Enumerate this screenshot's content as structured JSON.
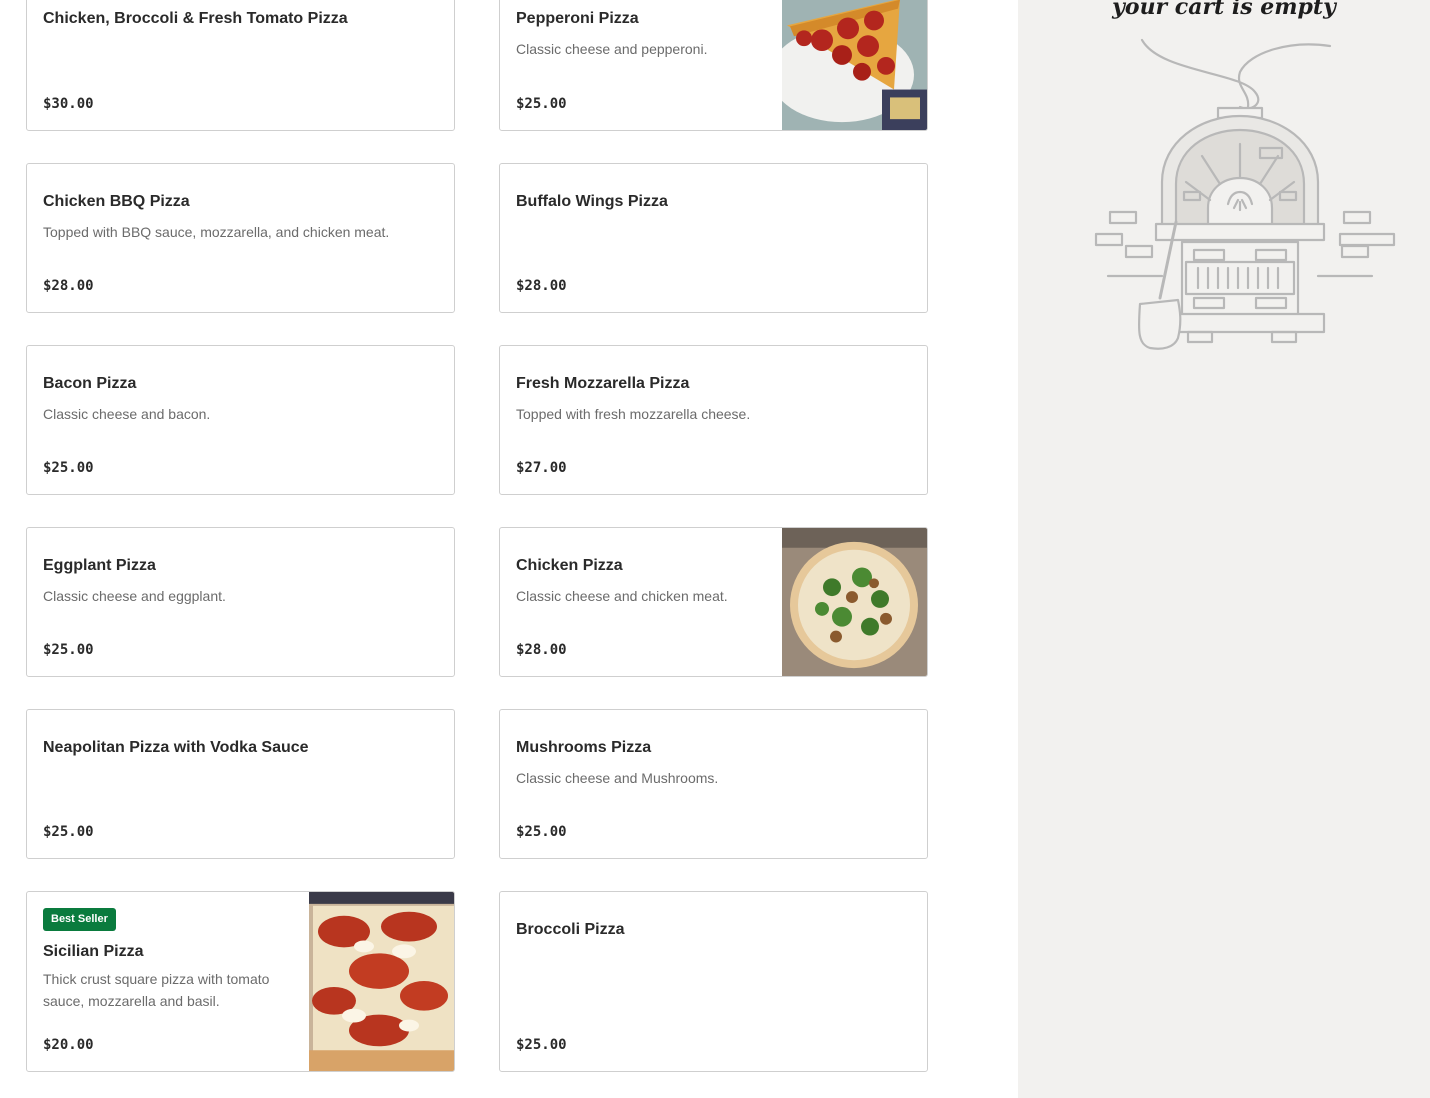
{
  "menu": {
    "items": [
      {
        "name": "Chicken, Broccoli & Fresh Tomato Pizza",
        "description": "",
        "price": "$30.00"
      },
      {
        "name": "Pepperoni Pizza",
        "description": "Classic cheese and pepperoni.",
        "price": "$25.00",
        "image": "pepperoni-slice-photo"
      },
      {
        "name": "Chicken BBQ Pizza",
        "description": "Topped with BBQ sauce, mozzarella, and chicken meat.",
        "price": "$28.00"
      },
      {
        "name": "Buffalo Wings Pizza",
        "description": "",
        "price": "$28.00"
      },
      {
        "name": "Bacon Pizza",
        "description": "Classic cheese and bacon.",
        "price": "$25.00"
      },
      {
        "name": "Fresh Mozzarella Pizza",
        "description": "Topped with fresh mozzarella cheese.",
        "price": "$27.00"
      },
      {
        "name": "Eggplant Pizza",
        "description": "Classic cheese and eggplant.",
        "price": "$25.00"
      },
      {
        "name": "Chicken Pizza",
        "description": "Classic cheese and chicken meat.",
        "price": "$28.00",
        "image": "chicken-pizza-photo"
      },
      {
        "name": "Neapolitan Pizza with Vodka Sauce",
        "description": "",
        "price": "$25.00"
      },
      {
        "name": "Mushrooms Pizza",
        "description": "Classic cheese and Mushrooms.",
        "price": "$25.00"
      },
      {
        "name": "Sicilian Pizza",
        "description": "Thick crust square pizza with tomato sauce, mozzarella and basil.",
        "price": "$20.00",
        "badge": "Best Seller",
        "image": "sicilian-pizza-photo"
      },
      {
        "name": "Broccoli Pizza",
        "description": "",
        "price": "$25.00"
      }
    ]
  },
  "cart": {
    "empty_message": "your cart is empty",
    "illustration": "pizza-oven-icon"
  },
  "colors": {
    "badge": "#0a7b3e",
    "cart_background": "#f2f1ef",
    "card_border": "#cfcfcf"
  }
}
